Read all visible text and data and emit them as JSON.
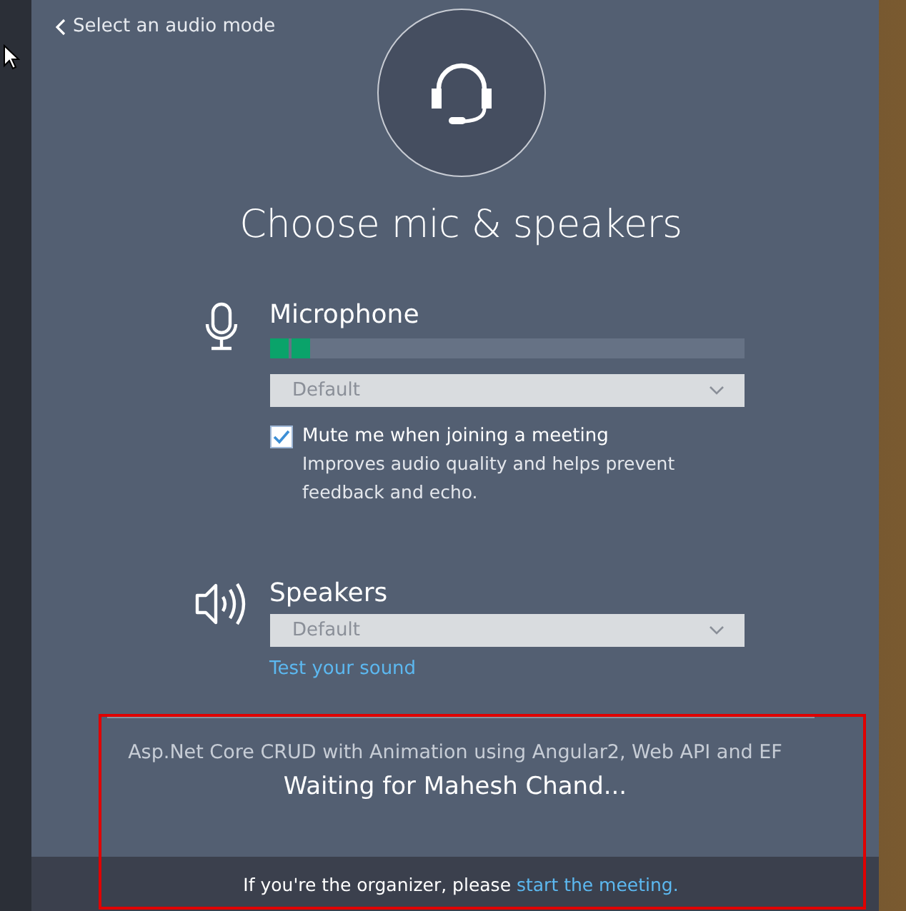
{
  "back_link": {
    "label": "Select an audio mode"
  },
  "title": "Choose mic & speakers",
  "devices": [
    {
      "kind": "microphone",
      "label": "Microphone",
      "level": 0.09,
      "dropdown": {
        "value": "Default"
      },
      "option": {
        "checked": true,
        "label": "Mute me when joining a meeting",
        "hint": "Improves audio quality and helps prevent feedback and echo."
      }
    },
    {
      "kind": "speakers",
      "label": "Speakers",
      "dropdown": {
        "value": "Default"
      },
      "link": "Test your sound"
    }
  ],
  "meeting": {
    "name": "Asp.Net Core CRUD with Animation using Angular2, Web API and EF",
    "status": "Waiting for Mahesh Chand..."
  },
  "footer": {
    "text": "If you're the organizer, please ",
    "link": "start the meeting."
  }
}
